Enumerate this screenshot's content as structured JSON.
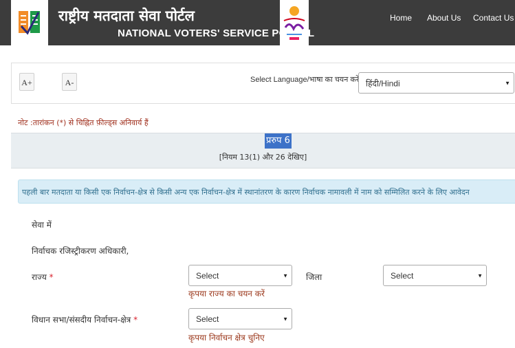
{
  "header": {
    "title_hi": "राष्ट्रीय मतदाता सेवा पोर्टल",
    "title_en": "NATIONAL VOTERS' SERVICE PORTAL",
    "nav": [
      {
        "label": "Home"
      },
      {
        "label": "About Us"
      },
      {
        "label": "Contact Us"
      }
    ]
  },
  "toolbar": {
    "increase_font": "A+",
    "decrease_font": "A-",
    "language_label": "Select Language/भाषा का चयन करें",
    "language_value": "हिंदी/Hindi"
  },
  "form": {
    "note": "नोट :तारांकन (*) से चिह्नित फ़ील्ड्स अनिवार्य हैं",
    "form_number": "प्ररुप 6",
    "rule": "[नियम 13(1) और 26 देखिए]",
    "info": "पहली बार मतदाता या किसी एक निर्वाचन-क्षेत्र से किसी अन्य एक निर्वाचन-क्षेत्र में स्थानांतरण के कारण निर्वाचक नामावली में नाम को सम्मिलित करने के लिए आवेदन",
    "to_label": "सेवा में",
    "officer_label": "निर्वाचक रजिस्ट्रीकरण अधिकारी,",
    "state": {
      "label": "राज्य",
      "required_mark": "*",
      "value": "Select",
      "error": "कृपया राज्य का चयन करें"
    },
    "district": {
      "label": "जिला",
      "value": "Select"
    },
    "constituency": {
      "label": "विधान सभा/संसदीय निर्वाचन-क्षेत्र",
      "required_mark": "*",
      "value": "Select",
      "error": "कृपया निर्वाचन क्षेत्र चुनिए"
    }
  },
  "colors": {
    "header_bg": "#3c3c3c",
    "note_text": "#a0301e",
    "highlight": "#3d72c8",
    "info_bg": "#d9edf7"
  }
}
